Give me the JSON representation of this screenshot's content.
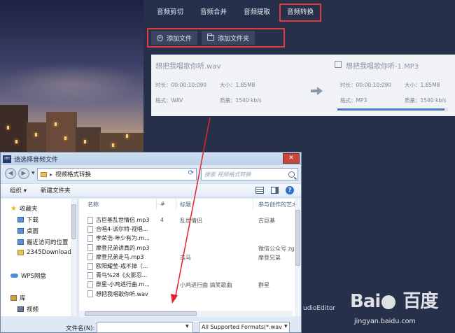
{
  "app": {
    "tabs": [
      "音频剪切",
      "音频合并",
      "音频提取",
      "音频转换"
    ],
    "active_tab_index": 3,
    "toolbar": {
      "add_file": "添加文件",
      "add_folder": "添加文件夹"
    },
    "file_card": {
      "source_name": "想把我唱歌你听.wav",
      "target_name": "想把我唱歌你听-1.MP3",
      "source_duration": "时长：00:00:10:090",
      "source_size": "大小：1.85MB",
      "source_format": "格式：WAV",
      "source_quality": "质量：1540 kb/s",
      "target_duration": "时长：00:00:10:090",
      "target_size": "大小：1.85MB",
      "target_format": "格式：MP3",
      "target_quality": "质量：1540 kb/s",
      "progress": 0.97
    },
    "footer_text": "udioEditor"
  },
  "dialog": {
    "title": "请选择音频文件",
    "app_icon_label": "HH",
    "address": {
      "folder": "视频格式转换"
    },
    "search_placeholder": "搜索 视频格式转换",
    "commands": {
      "organize": "组织 ▾",
      "new_folder": "新建文件夹"
    },
    "nav_items": {
      "favorites": "收藏夹",
      "downloads": "下载",
      "desktop": "桌面",
      "recent": "最近访问的位置",
      "custom_folder": "2345Download",
      "wps": "WPS网盘",
      "library": "库",
      "videos": "视频"
    },
    "columns": {
      "name": "名称",
      "number": "#",
      "title": "标题",
      "artist": "参与创作的艺术"
    },
    "files": [
      {
        "name": "古巨基乱世情侣.mp3",
        "number": "4",
        "title": "乱世情侣",
        "artist": "古巨基"
      },
      {
        "name": "合唱4-派尔特-视唱...",
        "number": "",
        "title": "",
        "artist": ""
      },
      {
        "name": "李荣浩-年少有为.m...",
        "number": "",
        "title": "",
        "artist": ""
      },
      {
        "name": "摩登兄弟讲真的.mp3",
        "number": "",
        "title": "",
        "artist": "微信公众号 zgc"
      },
      {
        "name": "摩登兄弟走马.mp3",
        "number": "",
        "title": "走马",
        "artist": "摩登兄弟"
      },
      {
        "name": "欧阳耀莹-戒不掉（...",
        "number": "",
        "title": "",
        "artist": ""
      },
      {
        "name": "青鸟%28《火影忍...",
        "number": "",
        "title": "",
        "artist": ""
      },
      {
        "name": "群星-小鸡进行曲.m...",
        "number": "",
        "title": "小鸡进行曲 搞笑歌曲",
        "artist": "群星"
      },
      {
        "name": "想把我唱歌你听.wav",
        "number": "",
        "title": "",
        "artist": ""
      }
    ],
    "filename_label": "文件名(N):",
    "filename_value": "",
    "filetype_value": "All Supported Formats(*.wav"
  },
  "watermark": {
    "brand": "Bai  百度",
    "url": "jingyan.baidu.com"
  }
}
